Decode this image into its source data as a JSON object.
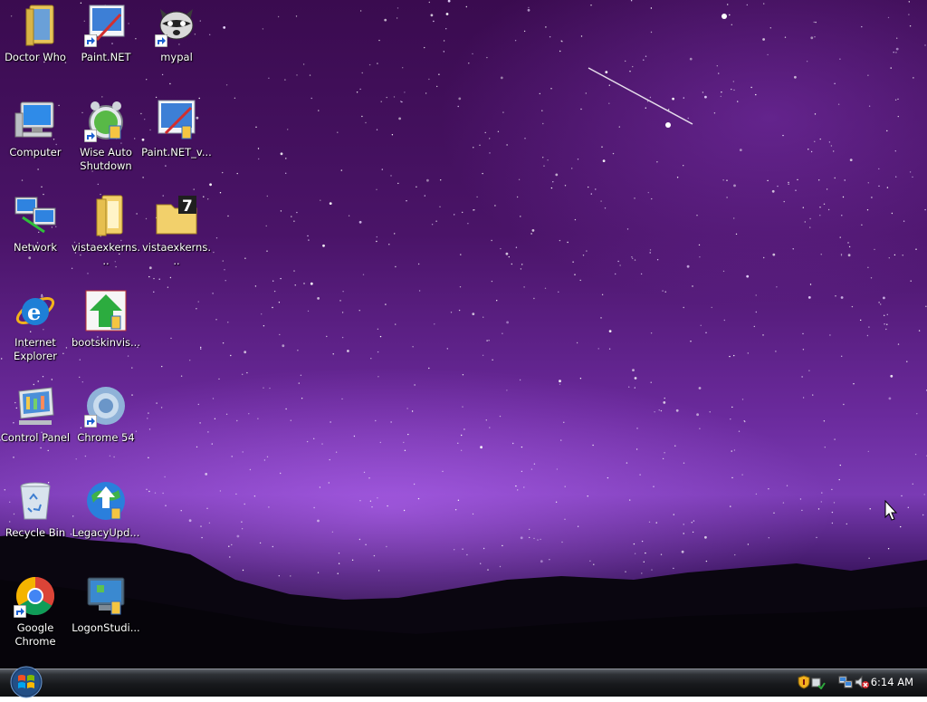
{
  "desktop": {
    "icons": [
      {
        "id": "doctor-who",
        "label": "Doctor Who"
      },
      {
        "id": "paint-net",
        "label": "Paint.NET"
      },
      {
        "id": "mypal",
        "label": "mypal"
      },
      {
        "id": "computer",
        "label": "Computer"
      },
      {
        "id": "wise-auto-shutdown",
        "label": "Wise Auto Shutdown"
      },
      {
        "id": "paint-net-v",
        "label": "Paint.NET_v..."
      },
      {
        "id": "network",
        "label": "Network"
      },
      {
        "id": "vistaexkerns-folder",
        "label": "vistaexkerns..."
      },
      {
        "id": "vistaexkerns-7z",
        "label": "vistaexkerns..."
      },
      {
        "id": "internet-explorer",
        "label": "Internet Explorer"
      },
      {
        "id": "bootskinvis",
        "label": "bootskinvis..."
      },
      {
        "id": "control-panel",
        "label": "Control Panel"
      },
      {
        "id": "chrome-54",
        "label": "Chrome 54"
      },
      {
        "id": "recycle-bin",
        "label": "Recycle Bin"
      },
      {
        "id": "legacyupd",
        "label": "LegacyUpd..."
      },
      {
        "id": "google-chrome",
        "label": "Google Chrome"
      },
      {
        "id": "logonstudio",
        "label": "LogonStudi..."
      }
    ]
  },
  "taskbar": {
    "clock": "6:14 AM",
    "tray_icons": [
      "security-shield-icon",
      "network-icon",
      "volume-muted-icon"
    ]
  },
  "colors": {
    "taskbar": "#17191c",
    "sky_purple": "#6a2a9c",
    "label_text": "#ffffff"
  }
}
